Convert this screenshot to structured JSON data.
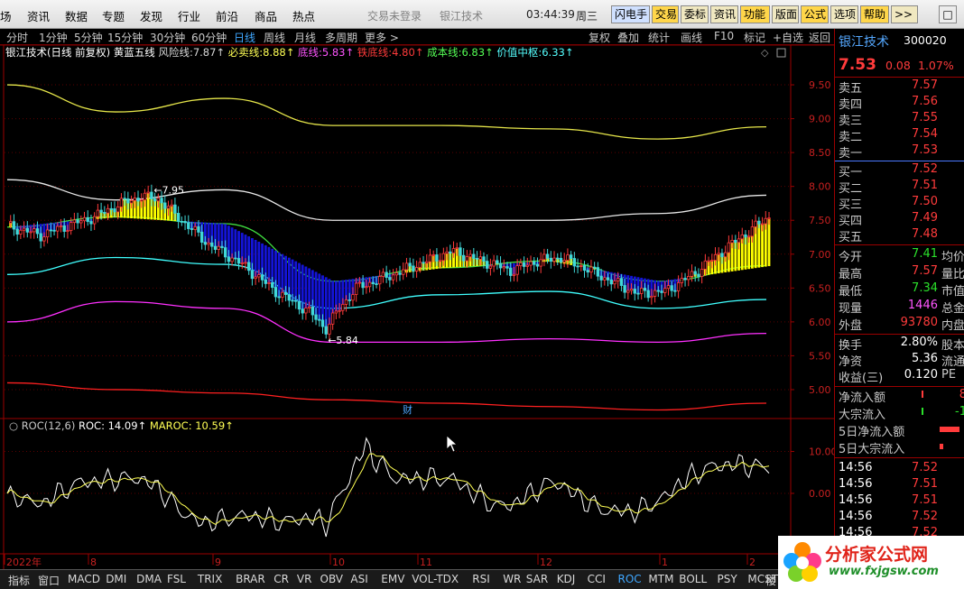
{
  "menubar": {
    "items": [
      "场",
      "资讯",
      "数据",
      "专题",
      "发现",
      "行业",
      "前沿",
      "商品",
      "热点"
    ],
    "trade_status": "交易未登录",
    "stock_title": "银江技术",
    "time": "03:44:39",
    "weekday": "周三",
    "buttons": [
      "闪电手",
      "交易",
      "委标",
      "资讯",
      "功能",
      "版面",
      "公式",
      "选项",
      "帮助",
      ">>"
    ]
  },
  "periodbar": {
    "items": [
      "分时",
      "1分钟",
      "5分钟",
      "15分钟",
      "30分钟",
      "60分钟",
      "日线",
      "周线",
      "月线",
      "多周期",
      "更多"
    ],
    "active": "日线",
    "tools": [
      "复权",
      "叠加",
      "统计",
      "画线",
      "F10",
      "标记",
      "+自选",
      "返回"
    ]
  },
  "main_chart": {
    "header_title": "银江技术(日线 前复权)",
    "indicator_name": "黄蓝五线",
    "legend": [
      {
        "label": "风险线:",
        "value": "7.87↑",
        "color": "#d8d8d8"
      },
      {
        "label": "必卖线:",
        "value": "8.88↑",
        "color": "#ffff55"
      },
      {
        "label": "底线:",
        "value": "5.83↑",
        "color": "#ff55ff"
      },
      {
        "label": "铁底线:",
        "value": "4.80↑",
        "color": "#ff3b3b"
      },
      {
        "label": "成本线:",
        "value": "6.83↑",
        "color": "#55ff55"
      },
      {
        "label": "价值中枢:",
        "value": "6.33↑",
        "color": "#55ffff"
      }
    ],
    "high_marker": "7.95",
    "low_marker": "5.84",
    "cai_mark": "财",
    "y_ticks": [
      "9.50",
      "9.00",
      "8.50",
      "8.00",
      "7.50",
      "7.00",
      "6.50",
      "6.00",
      "5.50",
      "5.00"
    ]
  },
  "sub_chart": {
    "title": "ROC(12,6)",
    "roc_label": "ROC:",
    "roc_value": "14.09↑",
    "maroc_label": "MAROC:",
    "maroc_value": "10.59↑",
    "y_ticks": [
      "10.00",
      "0.00"
    ]
  },
  "x_axis": {
    "labels": [
      "2022年",
      "8",
      "9",
      "10",
      "11",
      "12",
      "1",
      "2"
    ]
  },
  "right_panel": {
    "stock_name": "银江技术",
    "stock_code": "300020",
    "price": "7.53",
    "change": "0.08",
    "change_pct": "1.07%",
    "sells": [
      {
        "label": "卖五",
        "price": "7.57"
      },
      {
        "label": "卖四",
        "price": "7.56"
      },
      {
        "label": "卖三",
        "price": "7.55"
      },
      {
        "label": "卖二",
        "price": "7.54"
      },
      {
        "label": "卖一",
        "price": "7.53"
      }
    ],
    "buys": [
      {
        "label": "买一",
        "price": "7.52"
      },
      {
        "label": "买二",
        "price": "7.51"
      },
      {
        "label": "买三",
        "price": "7.50"
      },
      {
        "label": "买四",
        "price": "7.49"
      },
      {
        "label": "买五",
        "price": "7.48"
      }
    ],
    "stats": [
      {
        "label": "今开",
        "value": "7.41",
        "extra": "均价"
      },
      {
        "label": "最高",
        "value": "7.57",
        "extra": "量比"
      },
      {
        "label": "最低",
        "value": "7.34",
        "extra": "市值"
      },
      {
        "label": "现量",
        "value": "1446",
        "extra": "总金"
      },
      {
        "label": "外盘",
        "value": "93780",
        "extra": "内盘"
      }
    ],
    "stats2": [
      {
        "label": "换手",
        "value": "2.80%",
        "extra": "股本"
      },
      {
        "label": "净资",
        "value": "5.36",
        "extra": "流通"
      },
      {
        "label": "收益(三)",
        "value": "0.120",
        "extra": "PE"
      }
    ],
    "flows": [
      {
        "label": "净流入额",
        "value": "8"
      },
      {
        "label": "大宗流入",
        "value": "-1"
      },
      {
        "label": "5日净流入额",
        "value": ""
      },
      {
        "label": "5日大宗流入",
        "value": ""
      }
    ],
    "ticks": [
      {
        "time": "14:56",
        "price": "7.52"
      },
      {
        "time": "14:56",
        "price": "7.51"
      },
      {
        "time": "14:56",
        "price": "7.51"
      },
      {
        "time": "14:56",
        "price": "7.52"
      },
      {
        "time": "14:56",
        "price": "7.52"
      }
    ]
  },
  "tabs": {
    "items": [
      "指标",
      "窗口",
      "MACD",
      "DMI",
      "DMA",
      "FSL",
      "TRIX",
      "BRAR",
      "CR",
      "VR",
      "OBV",
      "ASI",
      "EMV",
      "VOL-TDX",
      "RSI",
      "WR",
      "SAR",
      "KDJ",
      "CCI",
      "ROC",
      "MTM",
      "BOLL",
      "PSY",
      "MCST",
      "∣"
    ],
    "active": "ROC",
    "corner": "楼"
  },
  "logo": {
    "main": "分析家公式网",
    "sub": "www.fxjgsw.com"
  },
  "colors": {
    "up": "#ff3b3b",
    "down": "#2be02b",
    "yellow_bar": "#ffff00",
    "blue_bar": "#1414d8",
    "risk_line": "#e8e8e8",
    "sell_line": "#e6e64a",
    "bottom_line": "#ff30ff",
    "iron_line": "#ff2020",
    "cost_line": "#40e040",
    "value_line": "#40ffff"
  },
  "chart_data": {
    "type": "line",
    "x": [
      "2022-07",
      "2022-08",
      "2022-09",
      "2022-10",
      "2022-11",
      "2022-12",
      "2023-01",
      "2023-02"
    ],
    "series": [
      {
        "name": "风险线",
        "values": [
          8.1,
          7.8,
          7.95,
          7.5,
          7.5,
          7.5,
          7.6,
          7.87
        ]
      },
      {
        "name": "必卖线",
        "values": [
          9.5,
          9.1,
          9.3,
          8.9,
          8.9,
          8.85,
          8.7,
          8.88
        ]
      },
      {
        "name": "底线",
        "values": [
          6.0,
          6.3,
          6.2,
          5.7,
          5.7,
          5.75,
          5.7,
          5.83
        ]
      },
      {
        "name": "铁底线",
        "values": [
          5.1,
          5.0,
          4.95,
          4.85,
          4.8,
          4.75,
          4.7,
          4.8
        ]
      },
      {
        "name": "成本线",
        "values": [
          7.4,
          7.55,
          7.45,
          6.6,
          6.8,
          6.9,
          6.6,
          6.83
        ]
      },
      {
        "name": "价值中枢",
        "values": [
          6.7,
          6.95,
          6.85,
          6.2,
          6.4,
          6.45,
          6.2,
          6.33
        ]
      }
    ],
    "ylim": [
      4.6,
      9.9
    ]
  }
}
